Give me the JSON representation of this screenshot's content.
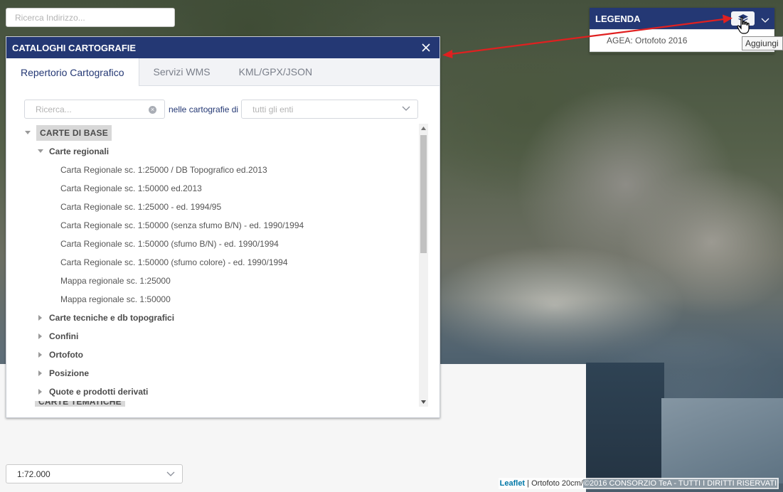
{
  "address_search": {
    "placeholder": "Ricerca Indirizzo..."
  },
  "catalog": {
    "title": "CATALOGHI CARTOGRAFIE",
    "tabs": [
      {
        "label": "Repertorio Cartografico",
        "active": true
      },
      {
        "label": "Servizi WMS",
        "active": false
      },
      {
        "label": "KML/GPX/JSON",
        "active": false
      }
    ],
    "search_placeholder": "Ricerca...",
    "filter_label": "nelle cartografie di",
    "filter_value": "tutti gli enti",
    "tree": {
      "root": "CARTE DI BASE",
      "group_open": "Carte regionali",
      "items": [
        "Carta Regionale sc. 1:25000 / DB Topografico ed.2013",
        "Carta Regionale sc. 1:50000 ed.2013",
        "Carta Regionale sc. 1:25000 - ed. 1994/95",
        "Carta Regionale sc. 1:50000 (senza sfumo B/N) - ed. 1990/1994",
        "Carta Regionale sc. 1:50000 (sfumo B/N) - ed. 1990/1994",
        "Carta Regionale sc. 1:50000 (sfumo colore) - ed. 1990/1994",
        "Mappa regionale sc. 1:25000",
        "Mappa regionale sc. 1:50000"
      ],
      "collapsed_groups": [
        "Carte tecniche e db topografici",
        "Confini",
        "Ortofoto",
        "Posizione",
        "Quote e prodotti derivati"
      ],
      "next_root": "CARTE TEMATICHE"
    }
  },
  "legend": {
    "title": "LEGENDA",
    "layer": "AGEA: Ortofoto 2016",
    "tooltip": "Aggiungi"
  },
  "scale": {
    "value": "1:72.000"
  },
  "attribution": {
    "leaflet": "Leaflet",
    "separator": " | ",
    "text": "Ortofoto 20cm/",
    "credit": "©2016 CONSORZIO TeA - TUTTI I DIRITTI RISERVATI"
  },
  "colors": {
    "header": "#243874",
    "annotation_arrow": "#e02020"
  }
}
